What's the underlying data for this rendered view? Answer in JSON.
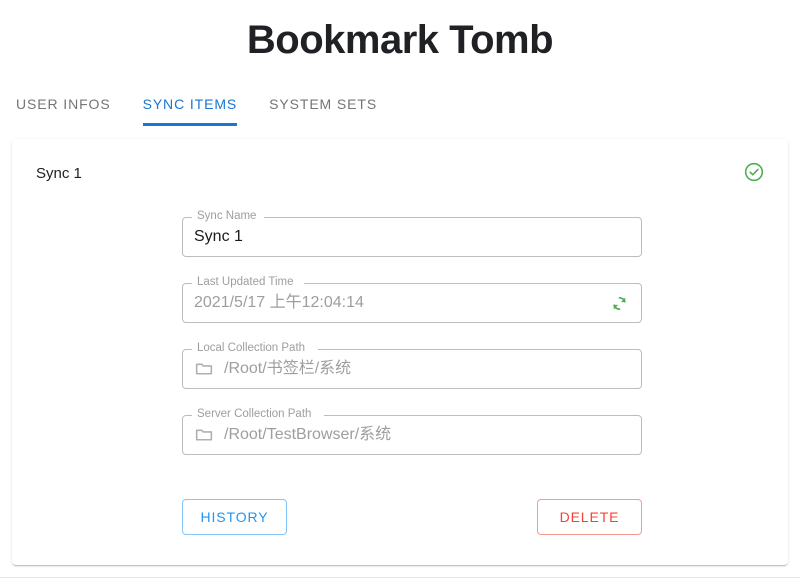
{
  "header": {
    "title": "Bookmark Tomb"
  },
  "tabs": {
    "items": [
      {
        "label": "USER INFOS",
        "active": false
      },
      {
        "label": "SYNC ITEMS",
        "active": true
      },
      {
        "label": "SYSTEM SETS",
        "active": false
      }
    ],
    "active_color": "#1976d2",
    "inactive_color": "#757575"
  },
  "card": {
    "title": "Sync 1",
    "status_icon": "check-circle-icon",
    "status_color": "#4caf50",
    "fields": [
      {
        "label": "Sync Name",
        "value": "Sync 1",
        "placeholder": "Sync Name",
        "muted": false,
        "leading_icon": null,
        "trailing_icon": null
      },
      {
        "label": "Last Updated Time",
        "value": "2021/5/17 上午12:04:14",
        "placeholder": "Last Updated Time",
        "muted": true,
        "leading_icon": null,
        "trailing_icon": "sync-refresh-icon"
      },
      {
        "label": "Local Collection Path",
        "value": "/Root/书签栏/系统",
        "placeholder": "Local Collection Path",
        "muted": true,
        "leading_icon": "folder-icon",
        "trailing_icon": null
      },
      {
        "label": "Server Collection Path",
        "value": "/Root/TestBrowser/系统",
        "placeholder": "Server Collection Path",
        "muted": true,
        "leading_icon": "folder-icon",
        "trailing_icon": null
      }
    ],
    "buttons": {
      "history_label": "HISTORY",
      "history_color": "#2196f3",
      "delete_label": "DELETE",
      "delete_color": "#f44336"
    },
    "icon_colors": {
      "sync_refresh": "#4caf50",
      "folder": "#b0b0b0"
    }
  }
}
